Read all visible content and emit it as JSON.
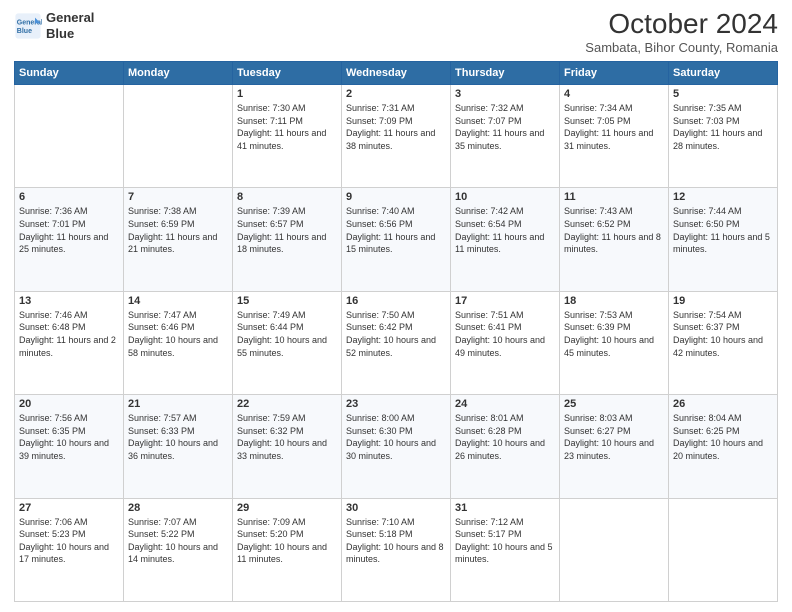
{
  "header": {
    "logo_line1": "General",
    "logo_line2": "Blue",
    "month": "October 2024",
    "location": "Sambata, Bihor County, Romania"
  },
  "days_of_week": [
    "Sunday",
    "Monday",
    "Tuesday",
    "Wednesday",
    "Thursday",
    "Friday",
    "Saturday"
  ],
  "weeks": [
    [
      {
        "day": "",
        "info": ""
      },
      {
        "day": "",
        "info": ""
      },
      {
        "day": "1",
        "info": "Sunrise: 7:30 AM\nSunset: 7:11 PM\nDaylight: 11 hours and 41 minutes."
      },
      {
        "day": "2",
        "info": "Sunrise: 7:31 AM\nSunset: 7:09 PM\nDaylight: 11 hours and 38 minutes."
      },
      {
        "day": "3",
        "info": "Sunrise: 7:32 AM\nSunset: 7:07 PM\nDaylight: 11 hours and 35 minutes."
      },
      {
        "day": "4",
        "info": "Sunrise: 7:34 AM\nSunset: 7:05 PM\nDaylight: 11 hours and 31 minutes."
      },
      {
        "day": "5",
        "info": "Sunrise: 7:35 AM\nSunset: 7:03 PM\nDaylight: 11 hours and 28 minutes."
      }
    ],
    [
      {
        "day": "6",
        "info": "Sunrise: 7:36 AM\nSunset: 7:01 PM\nDaylight: 11 hours and 25 minutes."
      },
      {
        "day": "7",
        "info": "Sunrise: 7:38 AM\nSunset: 6:59 PM\nDaylight: 11 hours and 21 minutes."
      },
      {
        "day": "8",
        "info": "Sunrise: 7:39 AM\nSunset: 6:57 PM\nDaylight: 11 hours and 18 minutes."
      },
      {
        "day": "9",
        "info": "Sunrise: 7:40 AM\nSunset: 6:56 PM\nDaylight: 11 hours and 15 minutes."
      },
      {
        "day": "10",
        "info": "Sunrise: 7:42 AM\nSunset: 6:54 PM\nDaylight: 11 hours and 11 minutes."
      },
      {
        "day": "11",
        "info": "Sunrise: 7:43 AM\nSunset: 6:52 PM\nDaylight: 11 hours and 8 minutes."
      },
      {
        "day": "12",
        "info": "Sunrise: 7:44 AM\nSunset: 6:50 PM\nDaylight: 11 hours and 5 minutes."
      }
    ],
    [
      {
        "day": "13",
        "info": "Sunrise: 7:46 AM\nSunset: 6:48 PM\nDaylight: 11 hours and 2 minutes."
      },
      {
        "day": "14",
        "info": "Sunrise: 7:47 AM\nSunset: 6:46 PM\nDaylight: 10 hours and 58 minutes."
      },
      {
        "day": "15",
        "info": "Sunrise: 7:49 AM\nSunset: 6:44 PM\nDaylight: 10 hours and 55 minutes."
      },
      {
        "day": "16",
        "info": "Sunrise: 7:50 AM\nSunset: 6:42 PM\nDaylight: 10 hours and 52 minutes."
      },
      {
        "day": "17",
        "info": "Sunrise: 7:51 AM\nSunset: 6:41 PM\nDaylight: 10 hours and 49 minutes."
      },
      {
        "day": "18",
        "info": "Sunrise: 7:53 AM\nSunset: 6:39 PM\nDaylight: 10 hours and 45 minutes."
      },
      {
        "day": "19",
        "info": "Sunrise: 7:54 AM\nSunset: 6:37 PM\nDaylight: 10 hours and 42 minutes."
      }
    ],
    [
      {
        "day": "20",
        "info": "Sunrise: 7:56 AM\nSunset: 6:35 PM\nDaylight: 10 hours and 39 minutes."
      },
      {
        "day": "21",
        "info": "Sunrise: 7:57 AM\nSunset: 6:33 PM\nDaylight: 10 hours and 36 minutes."
      },
      {
        "day": "22",
        "info": "Sunrise: 7:59 AM\nSunset: 6:32 PM\nDaylight: 10 hours and 33 minutes."
      },
      {
        "day": "23",
        "info": "Sunrise: 8:00 AM\nSunset: 6:30 PM\nDaylight: 10 hours and 30 minutes."
      },
      {
        "day": "24",
        "info": "Sunrise: 8:01 AM\nSunset: 6:28 PM\nDaylight: 10 hours and 26 minutes."
      },
      {
        "day": "25",
        "info": "Sunrise: 8:03 AM\nSunset: 6:27 PM\nDaylight: 10 hours and 23 minutes."
      },
      {
        "day": "26",
        "info": "Sunrise: 8:04 AM\nSunset: 6:25 PM\nDaylight: 10 hours and 20 minutes."
      }
    ],
    [
      {
        "day": "27",
        "info": "Sunrise: 7:06 AM\nSunset: 5:23 PM\nDaylight: 10 hours and 17 minutes."
      },
      {
        "day": "28",
        "info": "Sunrise: 7:07 AM\nSunset: 5:22 PM\nDaylight: 10 hours and 14 minutes."
      },
      {
        "day": "29",
        "info": "Sunrise: 7:09 AM\nSunset: 5:20 PM\nDaylight: 10 hours and 11 minutes."
      },
      {
        "day": "30",
        "info": "Sunrise: 7:10 AM\nSunset: 5:18 PM\nDaylight: 10 hours and 8 minutes."
      },
      {
        "day": "31",
        "info": "Sunrise: 7:12 AM\nSunset: 5:17 PM\nDaylight: 10 hours and 5 minutes."
      },
      {
        "day": "",
        "info": ""
      },
      {
        "day": "",
        "info": ""
      }
    ]
  ]
}
